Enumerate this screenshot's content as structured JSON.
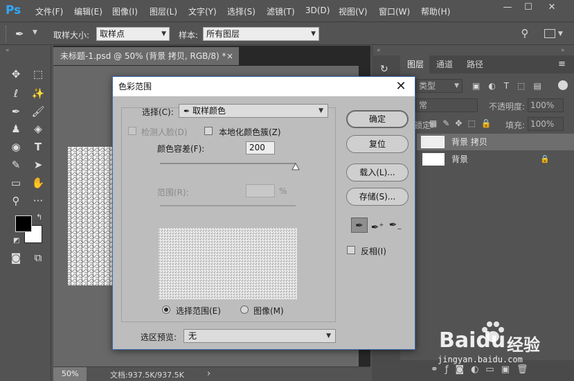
{
  "app": {
    "logo": "Ps",
    "menu": [
      "文件(F)",
      "编辑(E)",
      "图像(I)",
      "图层(L)",
      "文字(Y)",
      "选择(S)",
      "滤镜(T)",
      "3D(D)",
      "视图(V)",
      "窗口(W)",
      "帮助(H)"
    ],
    "window_buttons": [
      "—",
      "☐",
      "✕"
    ]
  },
  "options_bar": {
    "sample_size_label": "取样大小:",
    "sample_size_value": "取样点",
    "sample_label": "样本:",
    "sample_value": "所有图层"
  },
  "document": {
    "tab_title": "未标题-1.psd @ 50% (背景 拷贝, RGB/8) *",
    "tab_close": "×",
    "zoom": "50%",
    "doc_info": "文档:937.5K/937.5K",
    "status_arrow": "›"
  },
  "panels": {
    "tabs": [
      "图层",
      "通道",
      "路径"
    ],
    "filter_kind": "类型",
    "blend_mode": "常",
    "opacity_label": "不透明度:",
    "opacity_value": "100%",
    "lock_label": "锁定:",
    "fill_label": "填充:",
    "fill_value": "100%",
    "layers": [
      {
        "name": "背景 拷贝",
        "selected": true
      },
      {
        "name": "背景",
        "locked": true
      }
    ]
  },
  "dialog": {
    "title": "色彩范围",
    "close": "✕",
    "select_label": "选择(C):",
    "select_value": "取样颜色",
    "detect_faces_label": "检测人脸(D)",
    "localized_label": "本地化颜色簇(Z)",
    "fuzziness_label": "颜色容差(F):",
    "fuzziness_value": "200",
    "fuzziness_fraction": 1.0,
    "range_label": "范围(R):",
    "range_unit": "%",
    "range_value": "",
    "view_selection_label": "选择范围(E)",
    "view_image_label": "图像(M)",
    "view_mode": "selection",
    "preview_label": "选区预览:",
    "preview_value": "无",
    "buttons": {
      "ok": "确定",
      "reset": "复位",
      "load": "载入(L)...",
      "save": "存储(S)..."
    },
    "invert_label": "反相(I)"
  },
  "watermark": {
    "brand": "Baidu",
    "brand_cn": "经验",
    "url": "jingyan.baidu.com"
  }
}
